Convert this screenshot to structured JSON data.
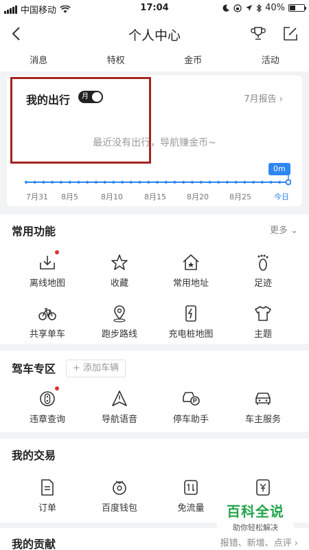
{
  "status_bar": {
    "carrier": "中国移动",
    "time": "17:04",
    "battery": "40%"
  },
  "nav": {
    "title": "个人中心"
  },
  "tabs": [
    "消息",
    "特权",
    "金币",
    "活动"
  ],
  "trip": {
    "title": "我的出行",
    "toggle_label": "月",
    "report": "7月报告",
    "empty_text": "最近没有出行，导航赚金币~",
    "distance": "0m",
    "dates": [
      "7月31",
      "8月5",
      "8月10",
      "8月15",
      "8月20",
      "8月25",
      "今日"
    ]
  },
  "common": {
    "title": "常用功能",
    "more": "更多",
    "items": [
      {
        "label": "离线地图",
        "icon": "download-icon",
        "dot": true
      },
      {
        "label": "收藏",
        "icon": "star-icon"
      },
      {
        "label": "常用地址",
        "icon": "home-star-icon"
      },
      {
        "label": "足迹",
        "icon": "footprint-icon"
      },
      {
        "label": "共享单车",
        "icon": "bike-icon"
      },
      {
        "label": "跑步路线",
        "icon": "location-pin-icon"
      },
      {
        "label": "充电桩地图",
        "icon": "charging-icon"
      },
      {
        "label": "主题",
        "icon": "tshirt-icon"
      }
    ]
  },
  "driving": {
    "title": "驾车专区",
    "add_car": "添加车辆",
    "items": [
      {
        "label": "违章查询",
        "icon": "violation-icon",
        "dot": true
      },
      {
        "label": "导航语音",
        "icon": "nav-voice-icon"
      },
      {
        "label": "停车助手",
        "icon": "parking-icon"
      },
      {
        "label": "车主服务",
        "icon": "car-icon"
      }
    ]
  },
  "transactions": {
    "title": "我的交易",
    "items": [
      {
        "label": "订单",
        "icon": "order-icon"
      },
      {
        "label": "百度钱包",
        "icon": "wallet-icon"
      },
      {
        "label": "免流量",
        "icon": "data-free-icon"
      },
      {
        "label": "",
        "icon": "coupon-icon"
      }
    ]
  },
  "contribution": {
    "title": "我的贡献",
    "links": "报错、新增、点评"
  },
  "watermark": {
    "main": "百科全说",
    "sub": "助你轻松解决"
  }
}
